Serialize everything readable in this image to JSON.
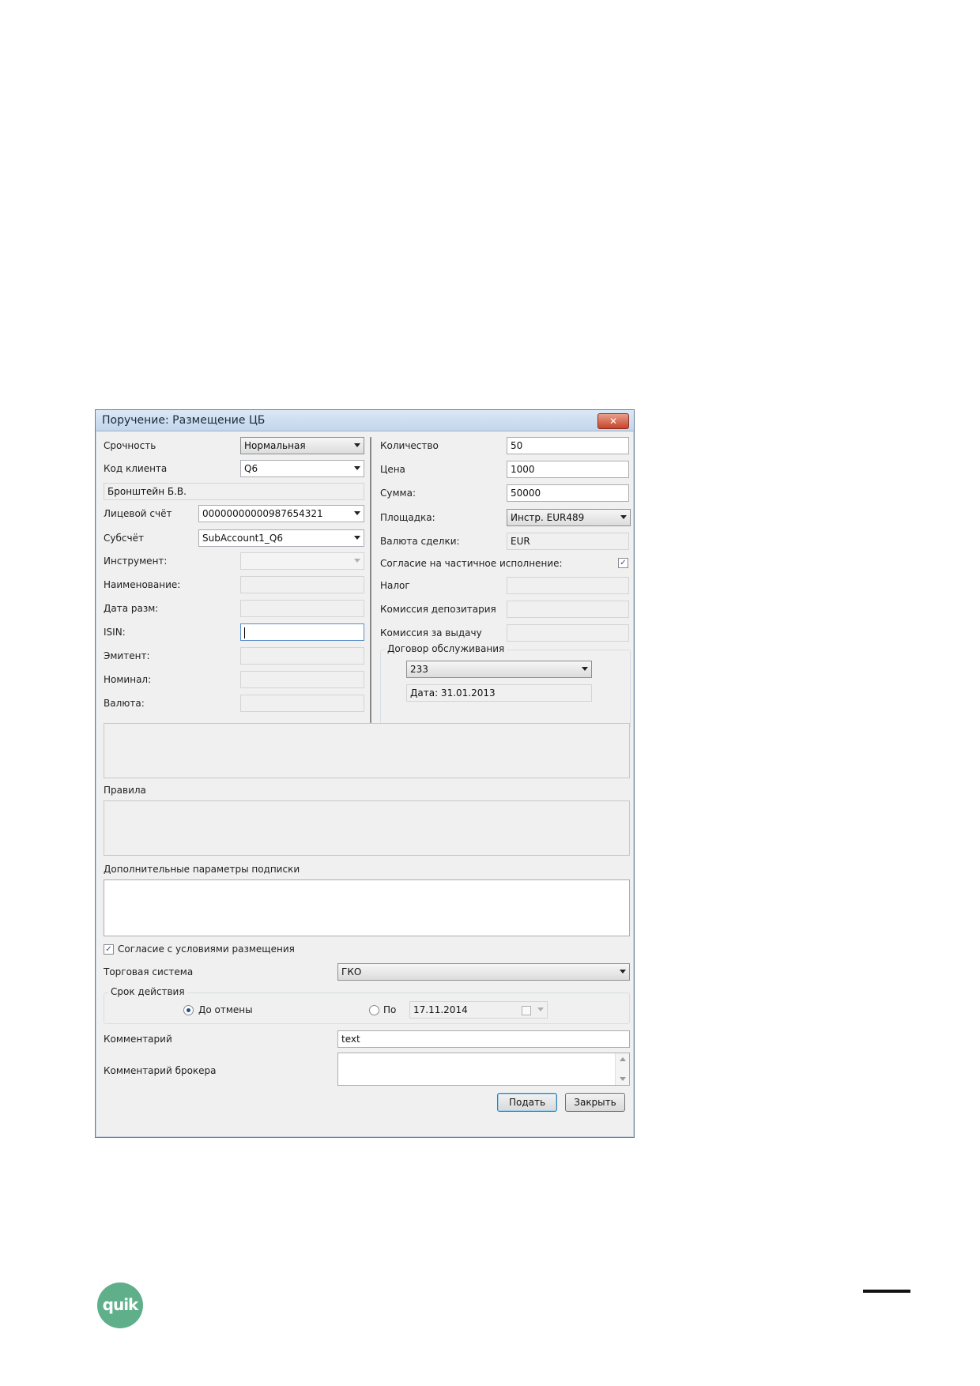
{
  "window": {
    "title": "Поручение: Размещение ЦБ",
    "close_glyph": "✕"
  },
  "left": {
    "urgency_label": "Срочность",
    "urgency_value": "Нормальная",
    "client_code_label": "Код клиента",
    "client_code_value": "Q6",
    "client_name": "Бронштейн Б.В.",
    "account_label": "Лицевой счёт",
    "account_value": "00000000000987654321",
    "subaccount_label": "Субсчёт",
    "subaccount_value": "SubAccount1_Q6",
    "instrument_label": "Инструмент:",
    "name_label": "Наименование:",
    "date_label": "Дата разм:",
    "isin_label": "ISIN:",
    "issuer_label": "Эмитент:",
    "nominal_label": "Номинал:",
    "currency_label": "Валюта:"
  },
  "right": {
    "quantity_label": "Количество",
    "quantity_value": "50",
    "price_label": "Цена",
    "price_value": "1000",
    "sum_label": "Сумма:",
    "sum_value": "50000",
    "venue_label": "Площадка:",
    "venue_value": "Инстр. EUR489",
    "deal_currency_label": "Валюта сделки:",
    "deal_currency_value": "EUR",
    "partial_label": "Согласие на частичное исполнение:",
    "tax_label": "Налог",
    "depository_fee_label": "Комиссия депозитария",
    "issue_fee_label": "Комиссия за выдачу",
    "contract_group_title": "Договор обслуживания",
    "contract_value": "233",
    "contract_date": "Дата: 31.01.2013"
  },
  "lower": {
    "rules_label": "Правила",
    "extra_params_label": "Дополнительные параметры подписки",
    "agree_label": "Согласие с условиями размещения",
    "trading_system_label": "Торговая система",
    "trading_system_value": "ГКО",
    "validity_group_title": "Срок действия",
    "until_cancel_label": "До отмены",
    "by_label": "По",
    "by_date": "17.11.2014",
    "comment_label": "Комментарий",
    "comment_value": "text",
    "broker_comment_label": "Комментарий брокера"
  },
  "buttons": {
    "submit": "Подать",
    "close": "Закрыть"
  },
  "footer": {
    "logo_text": "quik"
  },
  "colors": {
    "logo": "#5fb08a",
    "title_bar": "#c3d6ec",
    "close_button": "#c7442a"
  }
}
